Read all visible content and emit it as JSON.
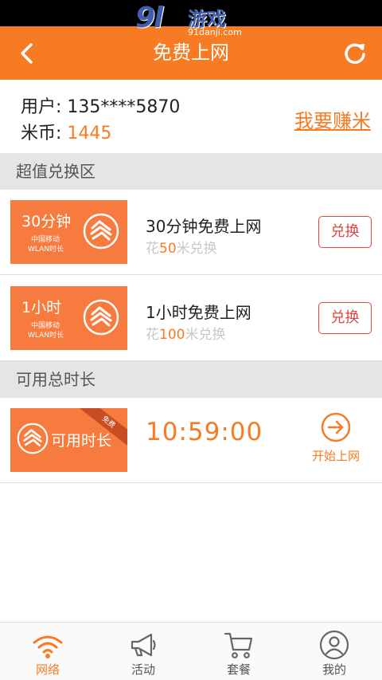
{
  "watermark": {
    "big": "9l",
    "cn": "游戏",
    "url": "91danji.com"
  },
  "header": {
    "title": "免费上网"
  },
  "account": {
    "user_label": "用户:",
    "user_value": "135****5870",
    "coin_label": "米币:",
    "coin_value": "1445",
    "earn_link": "我要赚米"
  },
  "sections": {
    "exchange": "超值兑换区",
    "available": "可用总时长"
  },
  "packages": [
    {
      "card_big": "30分钟",
      "card_line1": "中国移动",
      "card_line2": "WLAN时长",
      "title": "30分钟免费上网",
      "sub_prefix": "花",
      "price": "50",
      "sub_suffix": "米兑换",
      "button": "兑换"
    },
    {
      "card_big": "1小时",
      "card_line1": "中国移动",
      "card_line2": "WLAN时长",
      "title": "1小时免费上网",
      "sub_prefix": "花",
      "price": "100",
      "sub_suffix": "米兑换",
      "button": "兑换"
    }
  ],
  "available": {
    "card_text": "可用时长",
    "ribbon": "免费",
    "time": "10:59:00",
    "start_label": "开始上网"
  },
  "tabs": [
    {
      "label": "网络",
      "icon": "wifi-icon",
      "active": true
    },
    {
      "label": "活动",
      "icon": "megaphone-icon",
      "active": false
    },
    {
      "label": "套餐",
      "icon": "cart-icon",
      "active": false
    },
    {
      "label": "我的",
      "icon": "user-icon",
      "active": false
    }
  ],
  "colors": {
    "accent": "#f77b22",
    "card": "#f77b3e",
    "button": "#e0453f"
  }
}
